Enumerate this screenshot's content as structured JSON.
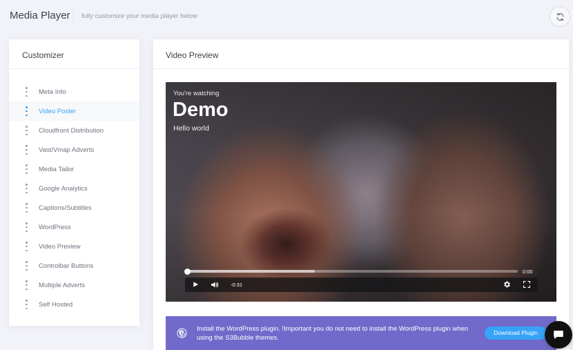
{
  "header": {
    "title": "Media Player",
    "subtitle": "fully customize your media player below",
    "refresh_icon": "refresh-icon"
  },
  "customizer": {
    "title": "Customizer",
    "active_index": 1,
    "items": [
      {
        "label": "Meta Info"
      },
      {
        "label": "Video Poster"
      },
      {
        "label": "Cloudfront Distribution"
      },
      {
        "label": "Vast/Vmap Adverts"
      },
      {
        "label": "Media Tailor"
      },
      {
        "label": "Google Analytics"
      },
      {
        "label": "Captions/Subtitles"
      },
      {
        "label": "WordPress"
      },
      {
        "label": "Video Preview"
      },
      {
        "label": "Controlbar Buttons"
      },
      {
        "label": "Multiple Adverts"
      },
      {
        "label": "Self Hosted"
      }
    ]
  },
  "preview": {
    "title": "Video Preview",
    "video": {
      "watching_label": "You're watching",
      "title": "Demo",
      "subtitle": "Hello world",
      "time_elapsed": "0:00",
      "time_remaining": "-0:31",
      "progress": 0.0,
      "buffered": 0.39
    },
    "notice": {
      "text": "Install the WordPress plugin. !Important you do not need to install the WordPress plugin when using the S3Bubble themes.",
      "button_label": "Download Plugin"
    }
  },
  "colors": {
    "accent": "#36a3f7",
    "notice_bg": "#716aca",
    "page_bg": "#f2f3f8"
  }
}
